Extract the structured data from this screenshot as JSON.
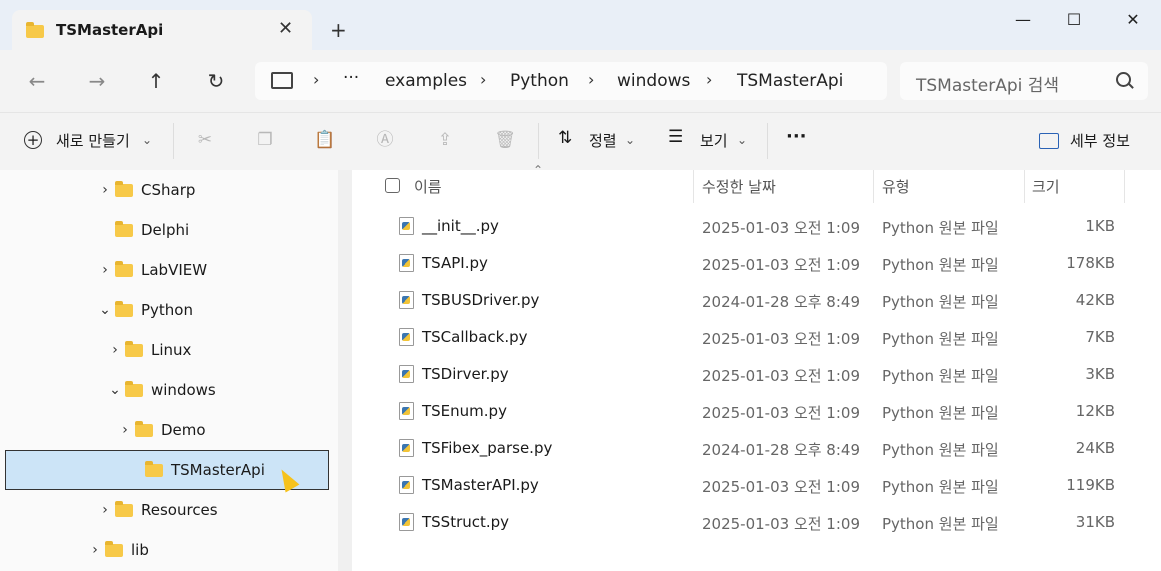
{
  "tab": {
    "title": "TSMasterApi",
    "close": "✕",
    "new_tab": "+"
  },
  "window": {
    "minimize": "—",
    "maximize": "☐",
    "close": "✕"
  },
  "nav": {
    "back": "←",
    "forward": "→",
    "up": "↑",
    "refresh": "↻"
  },
  "address": {
    "more": "···",
    "crumbs": [
      "examples",
      "Python",
      "windows",
      "TSMasterApi"
    ]
  },
  "search": {
    "placeholder": "TSMasterApi 검색"
  },
  "commands": {
    "new": "새로 만들기",
    "sort": "정렬",
    "view": "보기",
    "more": "···",
    "details": "세부 정보"
  },
  "sidebar": {
    "items": [
      {
        "label": "CSharp",
        "chevron": "›"
      },
      {
        "label": "Delphi",
        "chevron": ""
      },
      {
        "label": "LabVIEW",
        "chevron": "›"
      },
      {
        "label": "Python",
        "chevron": "⌄"
      },
      {
        "label": "Linux",
        "chevron": "›"
      },
      {
        "label": "windows",
        "chevron": "⌄"
      },
      {
        "label": "Demo",
        "chevron": "›"
      },
      {
        "label": "TSMasterApi",
        "chevron": ""
      },
      {
        "label": "Resources",
        "chevron": "›"
      },
      {
        "label": "lib",
        "chevron": "›"
      }
    ]
  },
  "columns": {
    "name": "이름",
    "date": "수정한 날짜",
    "type": "유형",
    "size": "크기"
  },
  "files": [
    {
      "name": "__init__.py",
      "date": "2025-01-03 오전 1:09",
      "type": "Python 원본 파일",
      "size": "1KB"
    },
    {
      "name": "TSAPI.py",
      "date": "2025-01-03 오전 1:09",
      "type": "Python 원본 파일",
      "size": "178KB"
    },
    {
      "name": "TSBUSDriver.py",
      "date": "2024-01-28 오후 8:49",
      "type": "Python 원본 파일",
      "size": "42KB"
    },
    {
      "name": "TSCallback.py",
      "date": "2025-01-03 오전 1:09",
      "type": "Python 원본 파일",
      "size": "7KB"
    },
    {
      "name": "TSDirver.py",
      "date": "2025-01-03 오전 1:09",
      "type": "Python 원본 파일",
      "size": "3KB"
    },
    {
      "name": "TSEnum.py",
      "date": "2025-01-03 오전 1:09",
      "type": "Python 원본 파일",
      "size": "12KB"
    },
    {
      "name": "TSFibex_parse.py",
      "date": "2024-01-28 오후 8:49",
      "type": "Python 원본 파일",
      "size": "24KB"
    },
    {
      "name": "TSMasterAPI.py",
      "date": "2025-01-03 오전 1:09",
      "type": "Python 원본 파일",
      "size": "119KB"
    },
    {
      "name": "TSStruct.py",
      "date": "2025-01-03 오전 1:09",
      "type": "Python 원본 파일",
      "size": "31KB"
    }
  ]
}
